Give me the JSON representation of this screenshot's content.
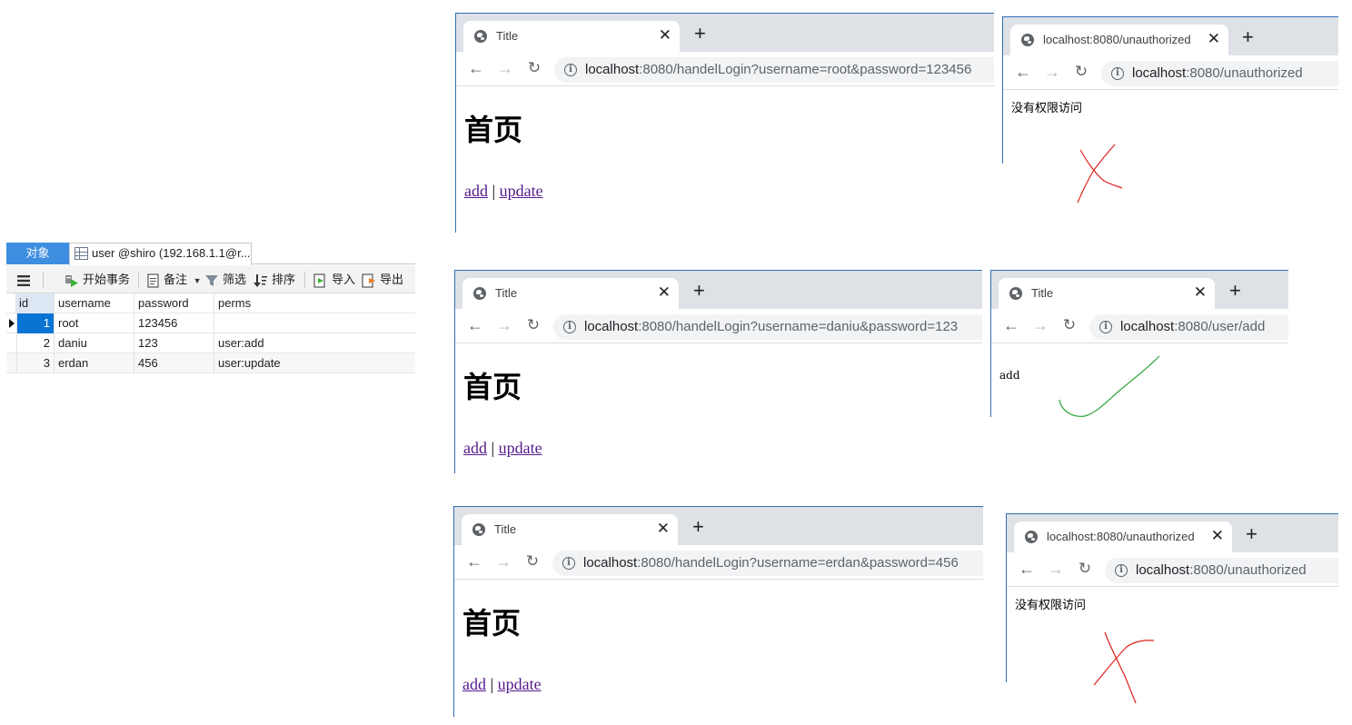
{
  "db_panel": {
    "tab_objects": "对象",
    "tab_table": "user @shiro (192.168.1.1@r...",
    "toolbar": {
      "menu_icon": "hamburger-icon",
      "begin_transaction": "开始事务",
      "memo": "备注",
      "filter": "筛选",
      "sort": "排序",
      "import": "导入",
      "export": "导出"
    },
    "columns": [
      "id",
      "username",
      "password",
      "perms"
    ],
    "rows": [
      {
        "id": "1",
        "username": "root",
        "password": "123456",
        "perms": ""
      },
      {
        "id": "2",
        "username": "daniu",
        "password": "123",
        "perms": "user:add"
      },
      {
        "id": "3",
        "username": "erdan",
        "password": "456",
        "perms": "user:update"
      }
    ]
  },
  "browsers": {
    "root_login": {
      "tab_title": "Title",
      "url_host": "localhost",
      "url_rest": ":8080/handelLogin?username=root&password=123456",
      "heading": "首页",
      "link_add": "add",
      "link_sep": " | ",
      "link_update": "update"
    },
    "root_result": {
      "tab_title": "localhost:8080/unauthorized",
      "url_host": "localhost",
      "url_rest": ":8080/unauthorized",
      "message": "没有权限访问",
      "mark": "red-cross"
    },
    "daniu_login": {
      "tab_title": "Title",
      "url_host": "localhost",
      "url_rest": ":8080/handelLogin?username=daniu&password=123",
      "heading": "首页",
      "link_add": "add",
      "link_sep": " | ",
      "link_update": "update"
    },
    "daniu_result": {
      "tab_title": "Title",
      "url_host": "localhost",
      "url_rest": ":8080/user/add",
      "message": "add",
      "mark": "green-check"
    },
    "erdan_login": {
      "tab_title": "Title",
      "url_host": "localhost",
      "url_rest": ":8080/handelLogin?username=erdan&password=456",
      "heading": "首页",
      "link_add": "add",
      "link_sep": " | ",
      "link_update": "update"
    },
    "erdan_result": {
      "tab_title": "localhost:8080/unauthorized",
      "url_host": "localhost",
      "url_rest": ":8080/unauthorized",
      "message": "没有权限访问",
      "mark": "red-cross"
    }
  },
  "colors": {
    "accent_tab": "#3d8ee0",
    "selected_cell": "#0a74d5",
    "link_visited": "#551a8b",
    "cross_red": "#e0201c",
    "check_green": "#2aa234"
  }
}
